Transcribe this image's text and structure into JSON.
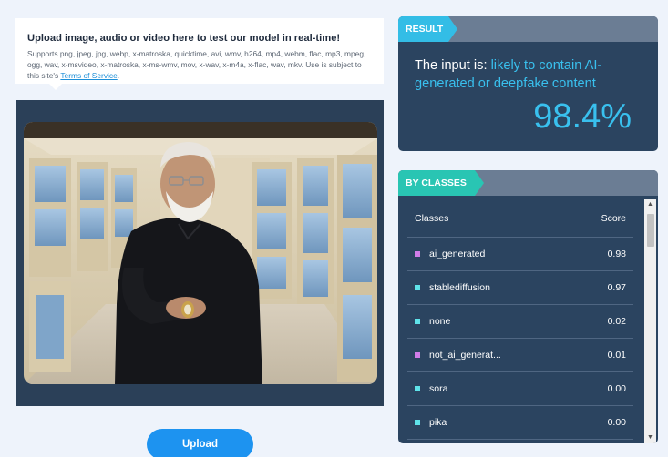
{
  "upload_info": {
    "title": "Upload image, audio or video here to test our model in real-time!",
    "formats_text": "Supports png, jpeg, jpg, webp, x-matroska, quicktime, avi, wmv, h264, mp4, webm, flac, mp3, mpeg, ogg, wav, x-msvideo, x-matroska, x-ms-wmv, mov, x-wav, x-m4a, x-flac, wav, mkv. Use is subject to this site's",
    "terms_link": "Terms of Service",
    "terms_suffix": "."
  },
  "upload_button": {
    "label": "Upload"
  },
  "result": {
    "tag": "RESULT",
    "prefix": "The input is:",
    "verdict": "likely to contain AI-generated or deepfake content",
    "score": "98.4%"
  },
  "classes": {
    "tag": "BY CLASSES",
    "col_class": "Classes",
    "col_score": "Score",
    "rows": [
      {
        "name": "ai_generated",
        "score": "0.98",
        "color": "#d07ce8"
      },
      {
        "name": "stablediffusion",
        "score": "0.97",
        "color": "#5fe3ea"
      },
      {
        "name": "none",
        "score": "0.02",
        "color": "#5fe3ea"
      },
      {
        "name": "not_ai_generat...",
        "score": "0.01",
        "color": "#d07ce8"
      },
      {
        "name": "sora",
        "score": "0.00",
        "color": "#5fe3ea"
      },
      {
        "name": "pika",
        "score": "0.00",
        "color": "#5fe3ea"
      }
    ]
  },
  "colors": {
    "accent_result": "#33bde6",
    "accent_classes": "#29c5b3",
    "card_bg": "#2b4460",
    "button": "#1d93f0"
  }
}
